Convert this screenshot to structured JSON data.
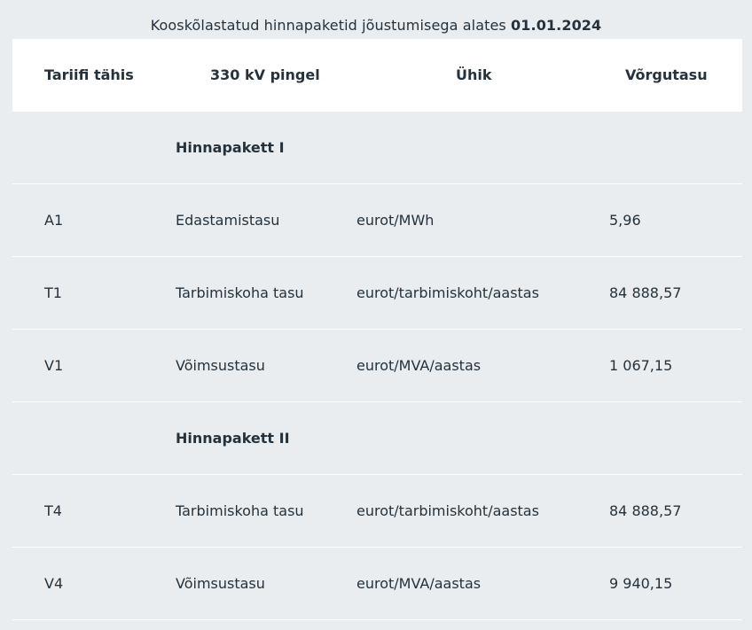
{
  "caption": {
    "text": "Kooskõlastatud hinnapaketid jõustumisega alates ",
    "date": "01.01.2024"
  },
  "table": {
    "headers": [
      "Tariifi tähis",
      "330 kV pingel",
      "Ühik",
      "Võrgutasu"
    ],
    "rows": [
      {
        "type": "group",
        "cells": [
          "",
          "Hinnapakett I",
          "",
          ""
        ]
      },
      {
        "type": "data",
        "cells": [
          "A1",
          "Edastamistasu",
          "eurot/MWh",
          "5,96"
        ]
      },
      {
        "type": "data",
        "cells": [
          "T1",
          "Tarbimiskoha tasu",
          "eurot/tarbimiskoht/aastas",
          "84 888,57"
        ]
      },
      {
        "type": "data",
        "cells": [
          "V1",
          "Võimsustasu",
          "eurot/MVA/aastas",
          "1 067,15"
        ]
      },
      {
        "type": "group",
        "cells": [
          "",
          "Hinnapakett II",
          "",
          ""
        ]
      },
      {
        "type": "data",
        "cells": [
          "T4",
          "Tarbimiskoha tasu",
          "eurot/tarbimiskoht/aastas",
          "84 888,57"
        ]
      },
      {
        "type": "data",
        "cells": [
          "V4",
          "Võimsustasu",
          "eurot/MVA/aastas",
          "9 940,15"
        ]
      }
    ]
  },
  "colors": {
    "page_background": "#e9edf0",
    "header_background": "#ffffff",
    "text": "#25323c",
    "row_divider": "#ffffff"
  }
}
